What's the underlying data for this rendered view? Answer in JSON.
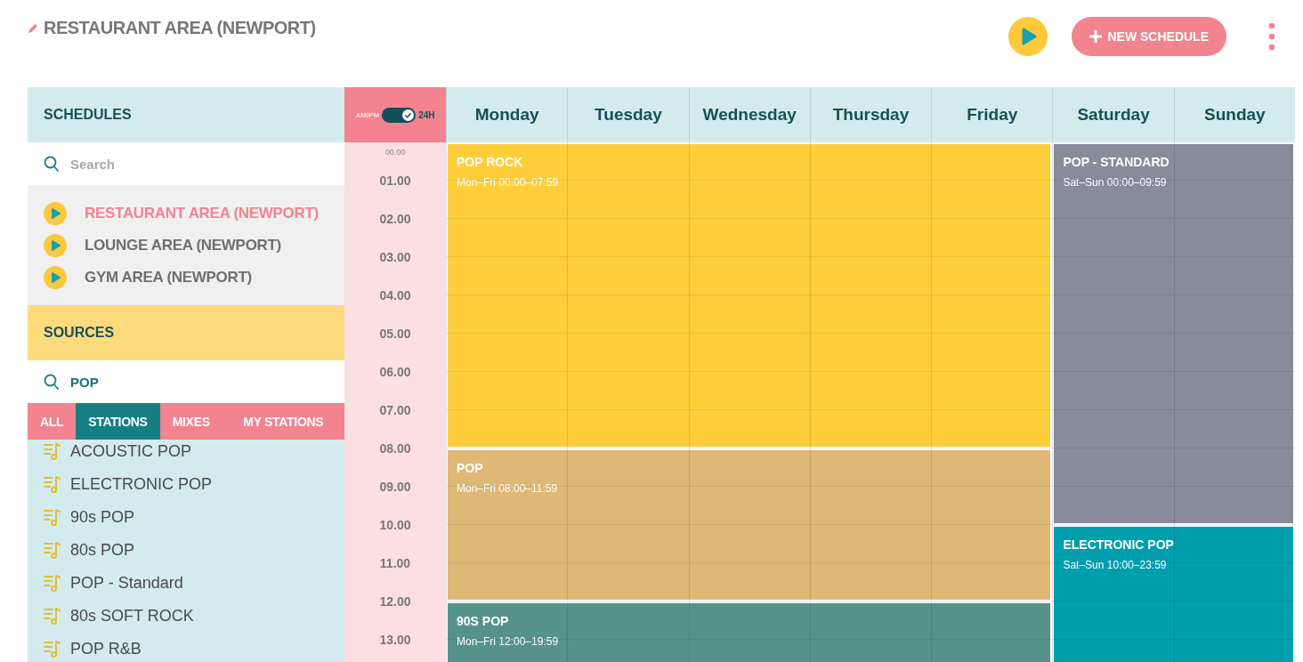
{
  "header": {
    "title": "RESTAURANT AREA (NEWPORT)",
    "new_button": "NEW SCHEDULE"
  },
  "schedules": {
    "heading": "SCHEDULES",
    "search": {
      "placeholder": "Search"
    },
    "items": [
      {
        "name": "RESTAURANT AREA (NEWPORT)",
        "selected": true
      },
      {
        "name": "LOUNGE AREA (NEWPORT)",
        "selected": false
      },
      {
        "name": "GYM AREA (NEWPORT)",
        "selected": false
      }
    ]
  },
  "sources": {
    "heading": "SOURCES",
    "search": {
      "value": "POP"
    },
    "tabs": [
      {
        "label": "ALL",
        "selected": false
      },
      {
        "label": "STATIONS",
        "selected": true
      },
      {
        "label": "MIXES",
        "selected": false
      },
      {
        "label": "MY STATIONS",
        "selected": false
      }
    ],
    "items": [
      "ACOUSTIC POP",
      "ELECTRONIC POP",
      "90s POP",
      "80s POP",
      "POP - Standard",
      "80s SOFT ROCK",
      "POP R&B"
    ]
  },
  "clock_toggle": {
    "left": "AM/PM",
    "right": "24H",
    "on": true
  },
  "hours": [
    "00.00",
    "01.00",
    "02.00",
    "03.00",
    "04.00",
    "05.00",
    "06.00",
    "07.00",
    "08.00",
    "09.00",
    "10.00",
    "11.00",
    "12.00",
    "13.00"
  ],
  "days": [
    "Monday",
    "Tuesday",
    "Wednesday",
    "Thursday",
    "Friday",
    "Saturday",
    "Sunday"
  ],
  "lanes": [
    {
      "kind": "weekdays",
      "blocks": [
        {
          "title": "POP ROCK",
          "subtitle": "Mon–Fri 00:00–07:59",
          "color": "#fecd3a"
        },
        {
          "title": "POP",
          "subtitle": "Mon–Fri 08:00–11:59",
          "color": "#deb874"
        },
        {
          "title": "90S POP",
          "subtitle": "Mon–Fri 12:00–19:59",
          "color": "#55938a"
        }
      ]
    },
    {
      "kind": "weekend",
      "blocks": [
        {
          "title": "POP - STANDARD",
          "subtitle": "Sat–Sun 00:00–09:59",
          "color": "#878b9a"
        },
        {
          "title": "ELECTRONIC POP",
          "subtitle": "Sat–Sun 10:00–23:59",
          "color": "#009fae"
        }
      ]
    }
  ]
}
